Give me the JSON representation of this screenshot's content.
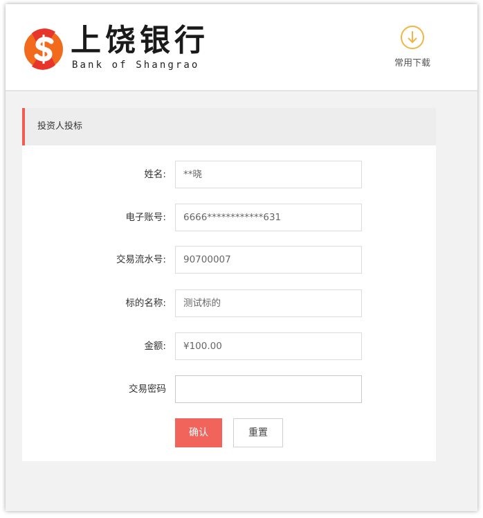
{
  "header": {
    "bank_name_cn": "上饶银行",
    "bank_name_en": "Bank of Shangrao",
    "download_label": "常用下载"
  },
  "form": {
    "title": "投资人投标",
    "fields": [
      {
        "label": "姓名:",
        "value": "**晓"
      },
      {
        "label": "电子账号:",
        "value": "6666************631"
      },
      {
        "label": "交易流水号:",
        "value": "90700007"
      },
      {
        "label": "标的名称:",
        "value": "测试标的"
      },
      {
        "label": "金额:",
        "value": "¥100.00"
      },
      {
        "label": "交易密码",
        "value": ""
      }
    ],
    "confirm_label": "确认",
    "reset_label": "重置"
  },
  "colors": {
    "accent": "#f15b50",
    "confirm_button": "#f0645c",
    "download_icon": "#f3b441"
  }
}
